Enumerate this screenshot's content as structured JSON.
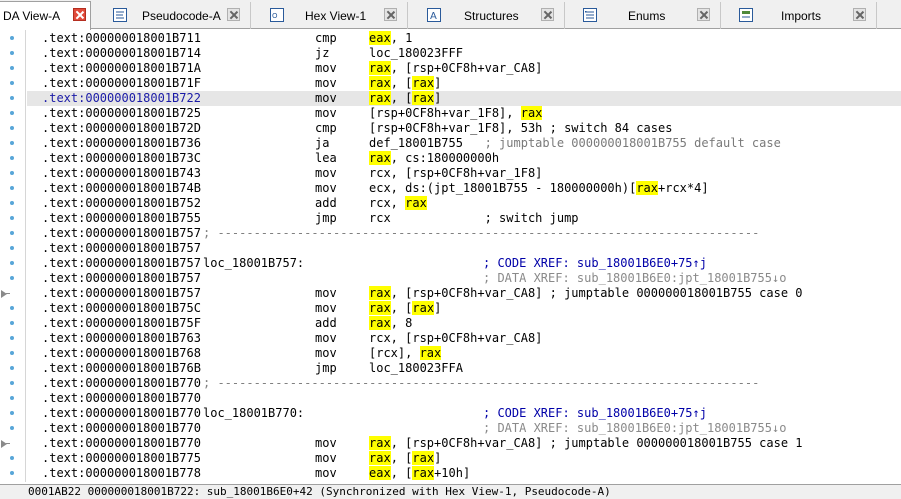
{
  "tabs": [
    {
      "label": "DA View-A",
      "icon": "ida-view-icon",
      "active": true
    },
    {
      "label": "Pseudocode-A",
      "icon": "pseudocode-icon",
      "active": false
    },
    {
      "label": "Hex View-1",
      "icon": "hex-view-icon",
      "active": false
    },
    {
      "label": "Structures",
      "icon": "structures-icon",
      "active": false
    },
    {
      "label": "Enums",
      "icon": "enums-icon",
      "active": false
    },
    {
      "label": "Imports",
      "icon": "imports-icon",
      "active": false
    }
  ],
  "listing": [
    {
      "addr": ".text:000000018001B711",
      "mn": "cmp",
      "ops": [
        [
          "eax",
          "hl"
        ],
        [
          ", 1",
          ""
        ]
      ]
    },
    {
      "addr": ".text:000000018001B714",
      "mn": "jz",
      "ops": [
        [
          "loc_180023FFF",
          ""
        ]
      ]
    },
    {
      "addr": ".text:000000018001B71A",
      "mn": "mov",
      "ops": [
        [
          "rax",
          "hl"
        ],
        [
          ", [rsp+0CF8h+var_CA8]",
          ""
        ]
      ]
    },
    {
      "addr": ".text:000000018001B71F",
      "mn": "mov",
      "ops": [
        [
          "rax",
          "hl"
        ],
        [
          ", [",
          ""
        ],
        [
          "rax",
          "hl"
        ],
        [
          "]",
          ""
        ]
      ]
    },
    {
      "addr": ".text:000000018001B722",
      "mn": "mov",
      "ops": [
        [
          "rax",
          "hl"
        ],
        [
          ", [",
          ""
        ],
        [
          "rax",
          "hl"
        ],
        [
          "]",
          ""
        ]
      ],
      "selected": true
    },
    {
      "addr": ".text:000000018001B725",
      "mn": "mov",
      "ops": [
        [
          "[rsp+0CF8h+var_1F8], ",
          ""
        ],
        [
          "rax",
          "hl"
        ]
      ]
    },
    {
      "addr": ".text:000000018001B72D",
      "mn": "cmp",
      "ops": [
        [
          "[rsp+0CF8h+var_1F8], 53h ; switch 84 cases",
          ""
        ]
      ]
    },
    {
      "addr": ".text:000000018001B736",
      "mn": "ja",
      "ops": [
        [
          "def_18001B755   ",
          ""
        ],
        [
          "; jumptable 000000018001B755 default case",
          "gr"
        ]
      ]
    },
    {
      "addr": ".text:000000018001B73C",
      "mn": "lea",
      "ops": [
        [
          "rax",
          "hl"
        ],
        [
          ", cs:180000000h",
          ""
        ]
      ]
    },
    {
      "addr": ".text:000000018001B743",
      "mn": "mov",
      "ops": [
        [
          "rcx, [rsp+0CF8h+var_1F8]",
          ""
        ]
      ]
    },
    {
      "addr": ".text:000000018001B74B",
      "mn": "mov",
      "ops": [
        [
          "ecx, ds:(jpt_18001B755 - 180000000h)[",
          ""
        ],
        [
          "rax",
          "hl"
        ],
        [
          "+rcx*4]",
          ""
        ]
      ]
    },
    {
      "addr": ".text:000000018001B752",
      "mn": "add",
      "ops": [
        [
          "rcx, ",
          ""
        ],
        [
          "rax",
          "hl"
        ]
      ]
    },
    {
      "addr": ".text:000000018001B755",
      "mn": "jmp",
      "ops": [
        [
          "rcx             ; switch jump",
          ""
        ]
      ]
    },
    {
      "addr": ".text:000000018001B757",
      "sep": "; ---------------------------------------------------------------------------"
    },
    {
      "addr": ".text:000000018001B757"
    },
    {
      "addr": ".text:000000018001B757",
      "label": "loc_18001B757:",
      "comment": [
        [
          "; CODE XREF: sub_18001B6E0+75↑j",
          "xref"
        ]
      ]
    },
    {
      "addr": ".text:000000018001B757",
      "comment": [
        [
          "; DATA XREF: sub_18001B6E0:jpt_18001B755↓o",
          "xref gray"
        ]
      ]
    },
    {
      "addr": ".text:000000018001B757",
      "mn": "mov",
      "ops": [
        [
          "rax",
          "hl"
        ],
        [
          ", [rsp+0CF8h+var_CA8] ; jumptable 000000018001B755 case 0",
          ""
        ]
      ]
    },
    {
      "addr": ".text:000000018001B75C",
      "mn": "mov",
      "ops": [
        [
          "rax",
          "hl"
        ],
        [
          ", [",
          ""
        ],
        [
          "rax",
          "hl"
        ],
        [
          "]",
          ""
        ]
      ]
    },
    {
      "addr": ".text:000000018001B75F",
      "mn": "add",
      "ops": [
        [
          "rax",
          "hl"
        ],
        [
          ", 8",
          ""
        ]
      ]
    },
    {
      "addr": ".text:000000018001B763",
      "mn": "mov",
      "ops": [
        [
          "rcx, [rsp+0CF8h+var_CA8]",
          ""
        ]
      ]
    },
    {
      "addr": ".text:000000018001B768",
      "mn": "mov",
      "ops": [
        [
          "[rcx], ",
          ""
        ],
        [
          "rax",
          "hl"
        ]
      ]
    },
    {
      "addr": ".text:000000018001B76B",
      "mn": "jmp",
      "ops": [
        [
          "loc_180023FFA",
          ""
        ]
      ]
    },
    {
      "addr": ".text:000000018001B770",
      "sep": "; ---------------------------------------------------------------------------"
    },
    {
      "addr": ".text:000000018001B770"
    },
    {
      "addr": ".text:000000018001B770",
      "label": "loc_18001B770:",
      "comment": [
        [
          "; CODE XREF: sub_18001B6E0+75↑j",
          "xref"
        ]
      ]
    },
    {
      "addr": ".text:000000018001B770",
      "comment": [
        [
          "; DATA XREF: sub_18001B6E0:jpt_18001B755↓o",
          "xref gray"
        ]
      ]
    },
    {
      "addr": ".text:000000018001B770",
      "mn": "mov",
      "ops": [
        [
          "rax",
          "hl"
        ],
        [
          ", [rsp+0CF8h+var_CA8] ; jumptable 000000018001B755 case 1",
          ""
        ]
      ]
    },
    {
      "addr": ".text:000000018001B775",
      "mn": "mov",
      "ops": [
        [
          "rax",
          "hl"
        ],
        [
          ", [",
          ""
        ],
        [
          "rax",
          "hl"
        ],
        [
          "]",
          ""
        ]
      ]
    },
    {
      "addr": ".text:000000018001B778",
      "mn": "mov",
      "ops": [
        [
          "eax",
          "hl"
        ],
        [
          ", [",
          ""
        ],
        [
          "rax",
          "hl"
        ],
        [
          "+10h]",
          ""
        ]
      ]
    }
  ],
  "status": {
    "text": "0001AB22 000000018001B722: sub_18001B6E0+42 (Synchronized with Hex View-1, Pseudocode-A)"
  },
  "colors": {
    "highlight": "#ffff00",
    "comment": "#0000a8",
    "gutter_dot": "#58a6d8",
    "active_close": "#e04a3a"
  }
}
